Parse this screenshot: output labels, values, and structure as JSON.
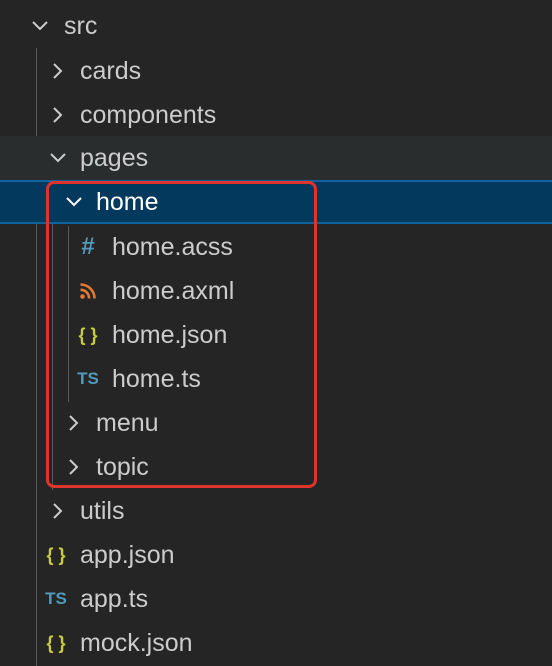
{
  "explorer": {
    "items": [
      {
        "label": "src",
        "kind": "folder",
        "expanded": true
      },
      {
        "label": "cards",
        "kind": "folder",
        "expanded": false
      },
      {
        "label": "components",
        "kind": "folder",
        "expanded": false
      },
      {
        "label": "pages",
        "kind": "folder",
        "expanded": true
      },
      {
        "label": "home",
        "kind": "folder",
        "expanded": true,
        "selected": true
      },
      {
        "label": "home.acss",
        "kind": "file",
        "icon": "hash-icon",
        "icon_glyph": "#",
        "icon_color": "#519aba"
      },
      {
        "label": "home.axml",
        "kind": "file",
        "icon": "rss-icon",
        "icon_color": "#e37933"
      },
      {
        "label": "home.json",
        "kind": "file",
        "icon": "braces-icon",
        "icon_glyph": "{ }",
        "icon_color": "#cbcb41"
      },
      {
        "label": "home.ts",
        "kind": "file",
        "icon": "ts-icon",
        "icon_glyph": "TS",
        "icon_color": "#519aba"
      },
      {
        "label": "menu",
        "kind": "folder",
        "expanded": false
      },
      {
        "label": "topic",
        "kind": "folder",
        "expanded": false
      },
      {
        "label": "utils",
        "kind": "folder",
        "expanded": false
      },
      {
        "label": "app.json",
        "kind": "file",
        "icon": "braces-icon",
        "icon_glyph": "{ }",
        "icon_color": "#cbcb41"
      },
      {
        "label": "app.ts",
        "kind": "file",
        "icon": "ts-icon",
        "icon_glyph": "TS",
        "icon_color": "#519aba"
      },
      {
        "label": "mock.json",
        "kind": "file",
        "icon": "braces-icon",
        "icon_glyph": "{ }",
        "icon_color": "#cbcb41"
      }
    ]
  },
  "colors": {
    "background": "#252526",
    "selection": "#04395e",
    "selection_border": "#0e639c",
    "highlight_box": "#e0332b",
    "text": "#cccccc"
  }
}
